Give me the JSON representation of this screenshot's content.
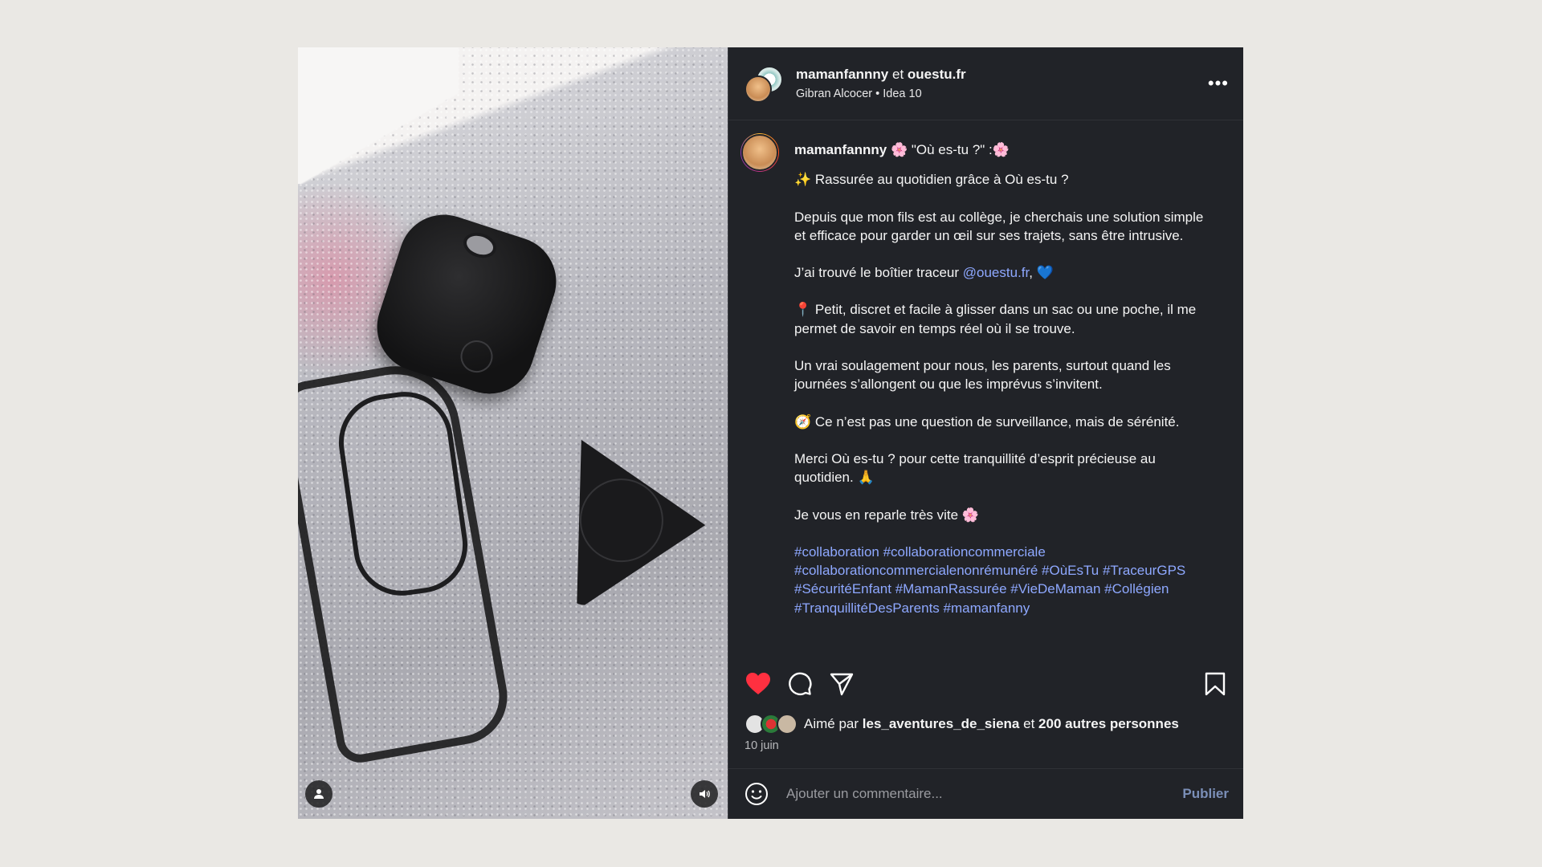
{
  "header": {
    "user1": "mamanfannny",
    "joiner": "et",
    "user2": "ouestu.fr",
    "music_artist": "Gibran Alcocer",
    "separator": "•",
    "music_title": "Idea 10"
  },
  "caption": {
    "username": "mamanfannny",
    "title": "🌸 \"Où es-tu ?\" :🌸",
    "p1": "✨ Rassurée au quotidien grâce à Où es-tu ?",
    "p2": "Depuis que mon fils est au collège, je cherchais une solution simple et efficace pour garder un œil sur ses trajets, sans être intrusive.",
    "p3_before": "J’ai trouvé le boîtier traceur ",
    "p3_mention": "@ouestu.fr",
    "p3_after": ", 💙",
    "p4": "📍 Petit, discret et facile à glisser dans un sac ou une poche, il me permet de savoir en temps réel où il se trouve.",
    "p5": "Un vrai soulagement pour nous, les parents, surtout quand les journées s’allongent ou que les imprévus s’invitent.",
    "p6": "🧭 Ce n’est pas une question de surveillance, mais de sérénité.",
    "p7": "Merci Où es-tu ? pour cette tranquillité d’esprit précieuse au quotidien. 🙏",
    "p8": "Je vous en reparle très vite 🌸",
    "hashtags": "#collaboration #collaborationcommerciale #collaborationcommercialenonrémunéré #OùEsTu #TraceurGPS #SécuritéEnfant #MamanRassurée #VieDeMaman #Collégien #TranquillitéDesParents #mamanfanny"
  },
  "likes": {
    "prefix": "Aimé par",
    "user": "les_aventures_de_siena",
    "joiner": "et",
    "others": "200 autres personnes"
  },
  "date": "10 juin",
  "comment": {
    "placeholder": "Ajouter un commentaire...",
    "publish": "Publier"
  },
  "icons": {
    "like": "heart-icon",
    "comment": "comment-icon",
    "share": "send-icon",
    "save": "bookmark-icon",
    "emoji": "emoji-icon",
    "more": "more-icon",
    "user_tag": "user-icon",
    "sound": "speaker-icon"
  },
  "colors": {
    "panel_bg": "#212328",
    "page_bg": "#eae8e4",
    "link": "#8ea8ff",
    "like_red": "#ff3040"
  }
}
